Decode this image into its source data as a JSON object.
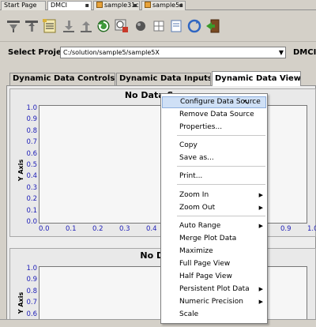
{
  "editor_tabs": [
    {
      "label": "Start Page",
      "active": false,
      "icon": ""
    },
    {
      "label": "DMCI",
      "active": true,
      "icon": ""
    },
    {
      "label": "sample31c",
      "active": false,
      "icon": "file-icon"
    },
    {
      "label": "sample5c",
      "active": false,
      "icon": "file-icon"
    }
  ],
  "toolbar": {
    "icons": [
      "pin-down-icon",
      "pin-up-icon",
      "chart-lines-icon",
      "download-icon",
      "upload-icon",
      "refresh-green-icon",
      "clock-stop-icon",
      "dot-circle-icon",
      "grid-icon",
      "document-icon",
      "sync-icon",
      "exit-icon"
    ]
  },
  "project": {
    "label": "Select Project",
    "value": "C:/solution/sample5/sample5X",
    "dmci_label": "DMCI"
  },
  "sub_tabs": [
    {
      "label": "Dynamic Data Controls",
      "active": false
    },
    {
      "label": "Dynamic Data Inputs",
      "active": false
    },
    {
      "label": "Dynamic Data View",
      "active": true
    }
  ],
  "plots": [
    {
      "title": "No Data Source",
      "y_axis_title": "Y Axis",
      "y_ticks": [
        "1.0",
        "0.9",
        "0.8",
        "0.7",
        "0.6",
        "0.5",
        "0.4",
        "0.3",
        "0.2",
        "0.1",
        "0.0"
      ],
      "x_ticks_left": [
        "0.0",
        "0.1",
        "0.2",
        "0.3",
        "0.4"
      ],
      "x_ticks_right": [
        "0.9",
        "1.0"
      ]
    },
    {
      "title": "No Da",
      "y_axis_title": "Y Axis",
      "y_ticks": [
        "1.0",
        "0.9",
        "0.8",
        "0.7",
        "0.6"
      ]
    }
  ],
  "context_menu": {
    "items": [
      {
        "label": "Configure Data Source",
        "highlighted": true,
        "submenu": false
      },
      {
        "label": "Remove Data Source",
        "highlighted": false,
        "submenu": false
      },
      {
        "label": "Properties...",
        "highlighted": false,
        "submenu": false
      },
      {
        "label": "Copy",
        "highlighted": false,
        "submenu": false
      },
      {
        "label": "Save as...",
        "highlighted": false,
        "submenu": false
      },
      {
        "label": "Print...",
        "highlighted": false,
        "submenu": false
      },
      {
        "label": "Zoom In",
        "highlighted": false,
        "submenu": true
      },
      {
        "label": "Zoom Out",
        "highlighted": false,
        "submenu": true
      },
      {
        "label": "Auto Range",
        "highlighted": false,
        "submenu": true
      },
      {
        "label": "Merge Plot Data",
        "highlighted": false,
        "submenu": false
      },
      {
        "label": "Maximize",
        "highlighted": false,
        "submenu": false
      },
      {
        "label": "Full Page View",
        "highlighted": false,
        "submenu": false
      },
      {
        "label": "Half Page View",
        "highlighted": false,
        "submenu": false
      },
      {
        "label": "Persistent Plot Data",
        "highlighted": false,
        "submenu": true
      },
      {
        "label": "Numeric Precision",
        "highlighted": false,
        "submenu": true
      },
      {
        "label": "Scale",
        "highlighted": false,
        "submenu": false
      }
    ]
  },
  "colors": {
    "tick_text": "#2020b8",
    "menu_highlight": "#cfe0f6",
    "window_bg": "#d4d0c8"
  }
}
